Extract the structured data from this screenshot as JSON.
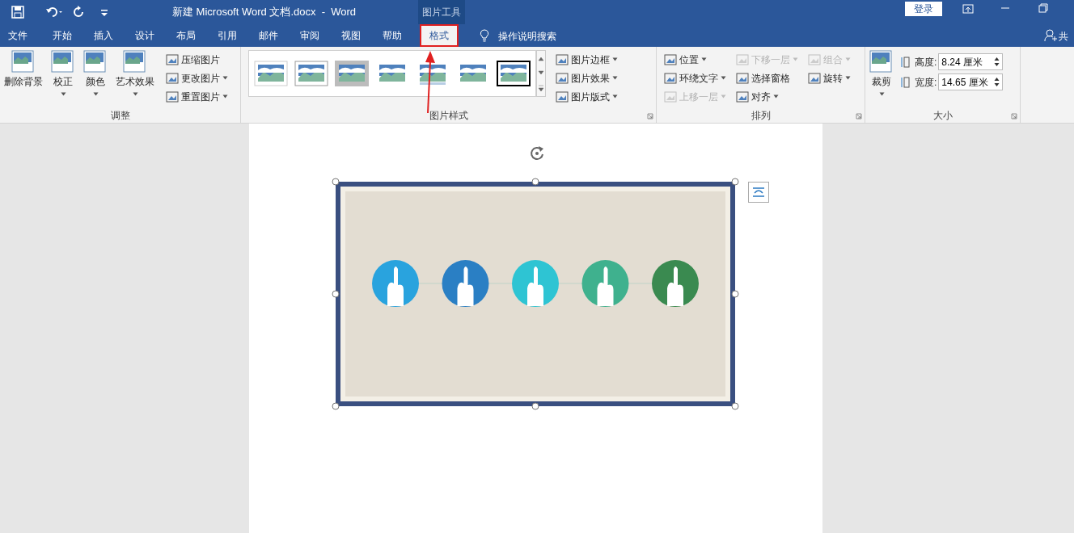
{
  "title_bar": {
    "title": "新建 Microsoft Word 文档.docx  -  Word",
    "context_label": "图片工具",
    "login": "登录"
  },
  "tabs": [
    {
      "label": "文件",
      "selected": false
    },
    {
      "label": "开始",
      "selected": false
    },
    {
      "label": "插入",
      "selected": false
    },
    {
      "label": "设计",
      "selected": false
    },
    {
      "label": "布局",
      "selected": false
    },
    {
      "label": "引用",
      "selected": false
    },
    {
      "label": "邮件",
      "selected": false
    },
    {
      "label": "审阅",
      "selected": false
    },
    {
      "label": "视图",
      "selected": false
    },
    {
      "label": "帮助",
      "selected": false
    },
    {
      "label": "格式",
      "selected": true
    }
  ],
  "tell_me": "操作说明搜索",
  "share": "共",
  "groups": [
    {
      "title": "调整",
      "large": [
        {
          "label": "删除背景",
          "dropdown": false
        },
        {
          "label": "校正",
          "dropdown": true
        },
        {
          "label": "颜色",
          "dropdown": true
        },
        {
          "label": "艺术效果",
          "dropdown": true
        }
      ],
      "small": [
        [
          {
            "label": "压缩图片",
            "dropdown": false,
            "disabled": false
          },
          {
            "label": "更改图片",
            "dropdown": true,
            "disabled": false
          },
          {
            "label": "重置图片",
            "dropdown": true,
            "disabled": false
          }
        ]
      ]
    },
    {
      "title": "图片样式",
      "styles": [
        {
          "kind": "plain"
        },
        {
          "kind": "framed"
        },
        {
          "kind": "thick"
        },
        {
          "kind": "soft"
        },
        {
          "kind": "reflect"
        },
        {
          "kind": "feather"
        },
        {
          "kind": "black"
        }
      ],
      "small": [
        [
          {
            "label": "图片边框",
            "dropdown": true,
            "disabled": false
          },
          {
            "label": "图片效果",
            "dropdown": true,
            "disabled": false
          },
          {
            "label": "图片版式",
            "dropdown": true,
            "disabled": false
          }
        ]
      ]
    },
    {
      "title": "排列",
      "small": [
        [
          {
            "label": "位置",
            "dropdown": true,
            "disabled": false
          },
          {
            "label": "环绕文字",
            "dropdown": true,
            "disabled": false
          },
          {
            "label": "上移一层",
            "dropdown": true,
            "disabled": true
          }
        ],
        [
          {
            "label": "下移一层",
            "dropdown": true,
            "disabled": true
          },
          {
            "label": "选择窗格",
            "dropdown": false,
            "disabled": false
          },
          {
            "label": "对齐",
            "dropdown": true,
            "disabled": false
          }
        ],
        [
          {
            "label": "组合",
            "dropdown": true,
            "disabled": true
          },
          {
            "label": "旋转",
            "dropdown": true,
            "disabled": false
          }
        ]
      ]
    },
    {
      "title": "大小",
      "large": [
        {
          "label": "裁剪",
          "dropdown": true
        }
      ],
      "fields": [
        {
          "label": "高度:",
          "value": "8.24 厘米"
        },
        {
          "label": "宽度:",
          "value": "14.65 厘米"
        }
      ]
    }
  ],
  "picture": {
    "hands": [
      {
        "color": "#29a3de"
      },
      {
        "color": "#2a7fc4"
      },
      {
        "color": "#2ec4d3"
      },
      {
        "color": "#3fb18e"
      },
      {
        "color": "#3a8a50"
      }
    ]
  }
}
